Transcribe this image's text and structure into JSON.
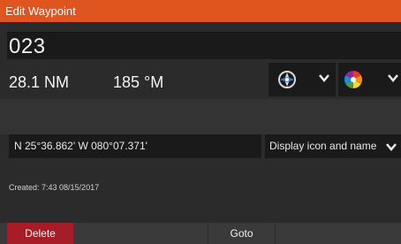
{
  "dialog": {
    "title": "Edit Waypoint"
  },
  "waypoint": {
    "name": "023",
    "distance": "28.1 NM",
    "bearing": "185 °M",
    "position": "N 25°36.862'   W 080°07.371'",
    "display_mode": "Display icon and name",
    "created": "Created: 7:43   08/15/2017"
  },
  "selectors": {
    "icon": "waypoint-crosshair-icon",
    "color": "color-wheel-icon"
  },
  "buttons": {
    "delete": "Delete",
    "goto": "Goto"
  },
  "colors": {
    "titlebar": "#e0541f",
    "delete": "#a71d27",
    "background": "#2b2b2b",
    "field": "#1a1a1a"
  }
}
